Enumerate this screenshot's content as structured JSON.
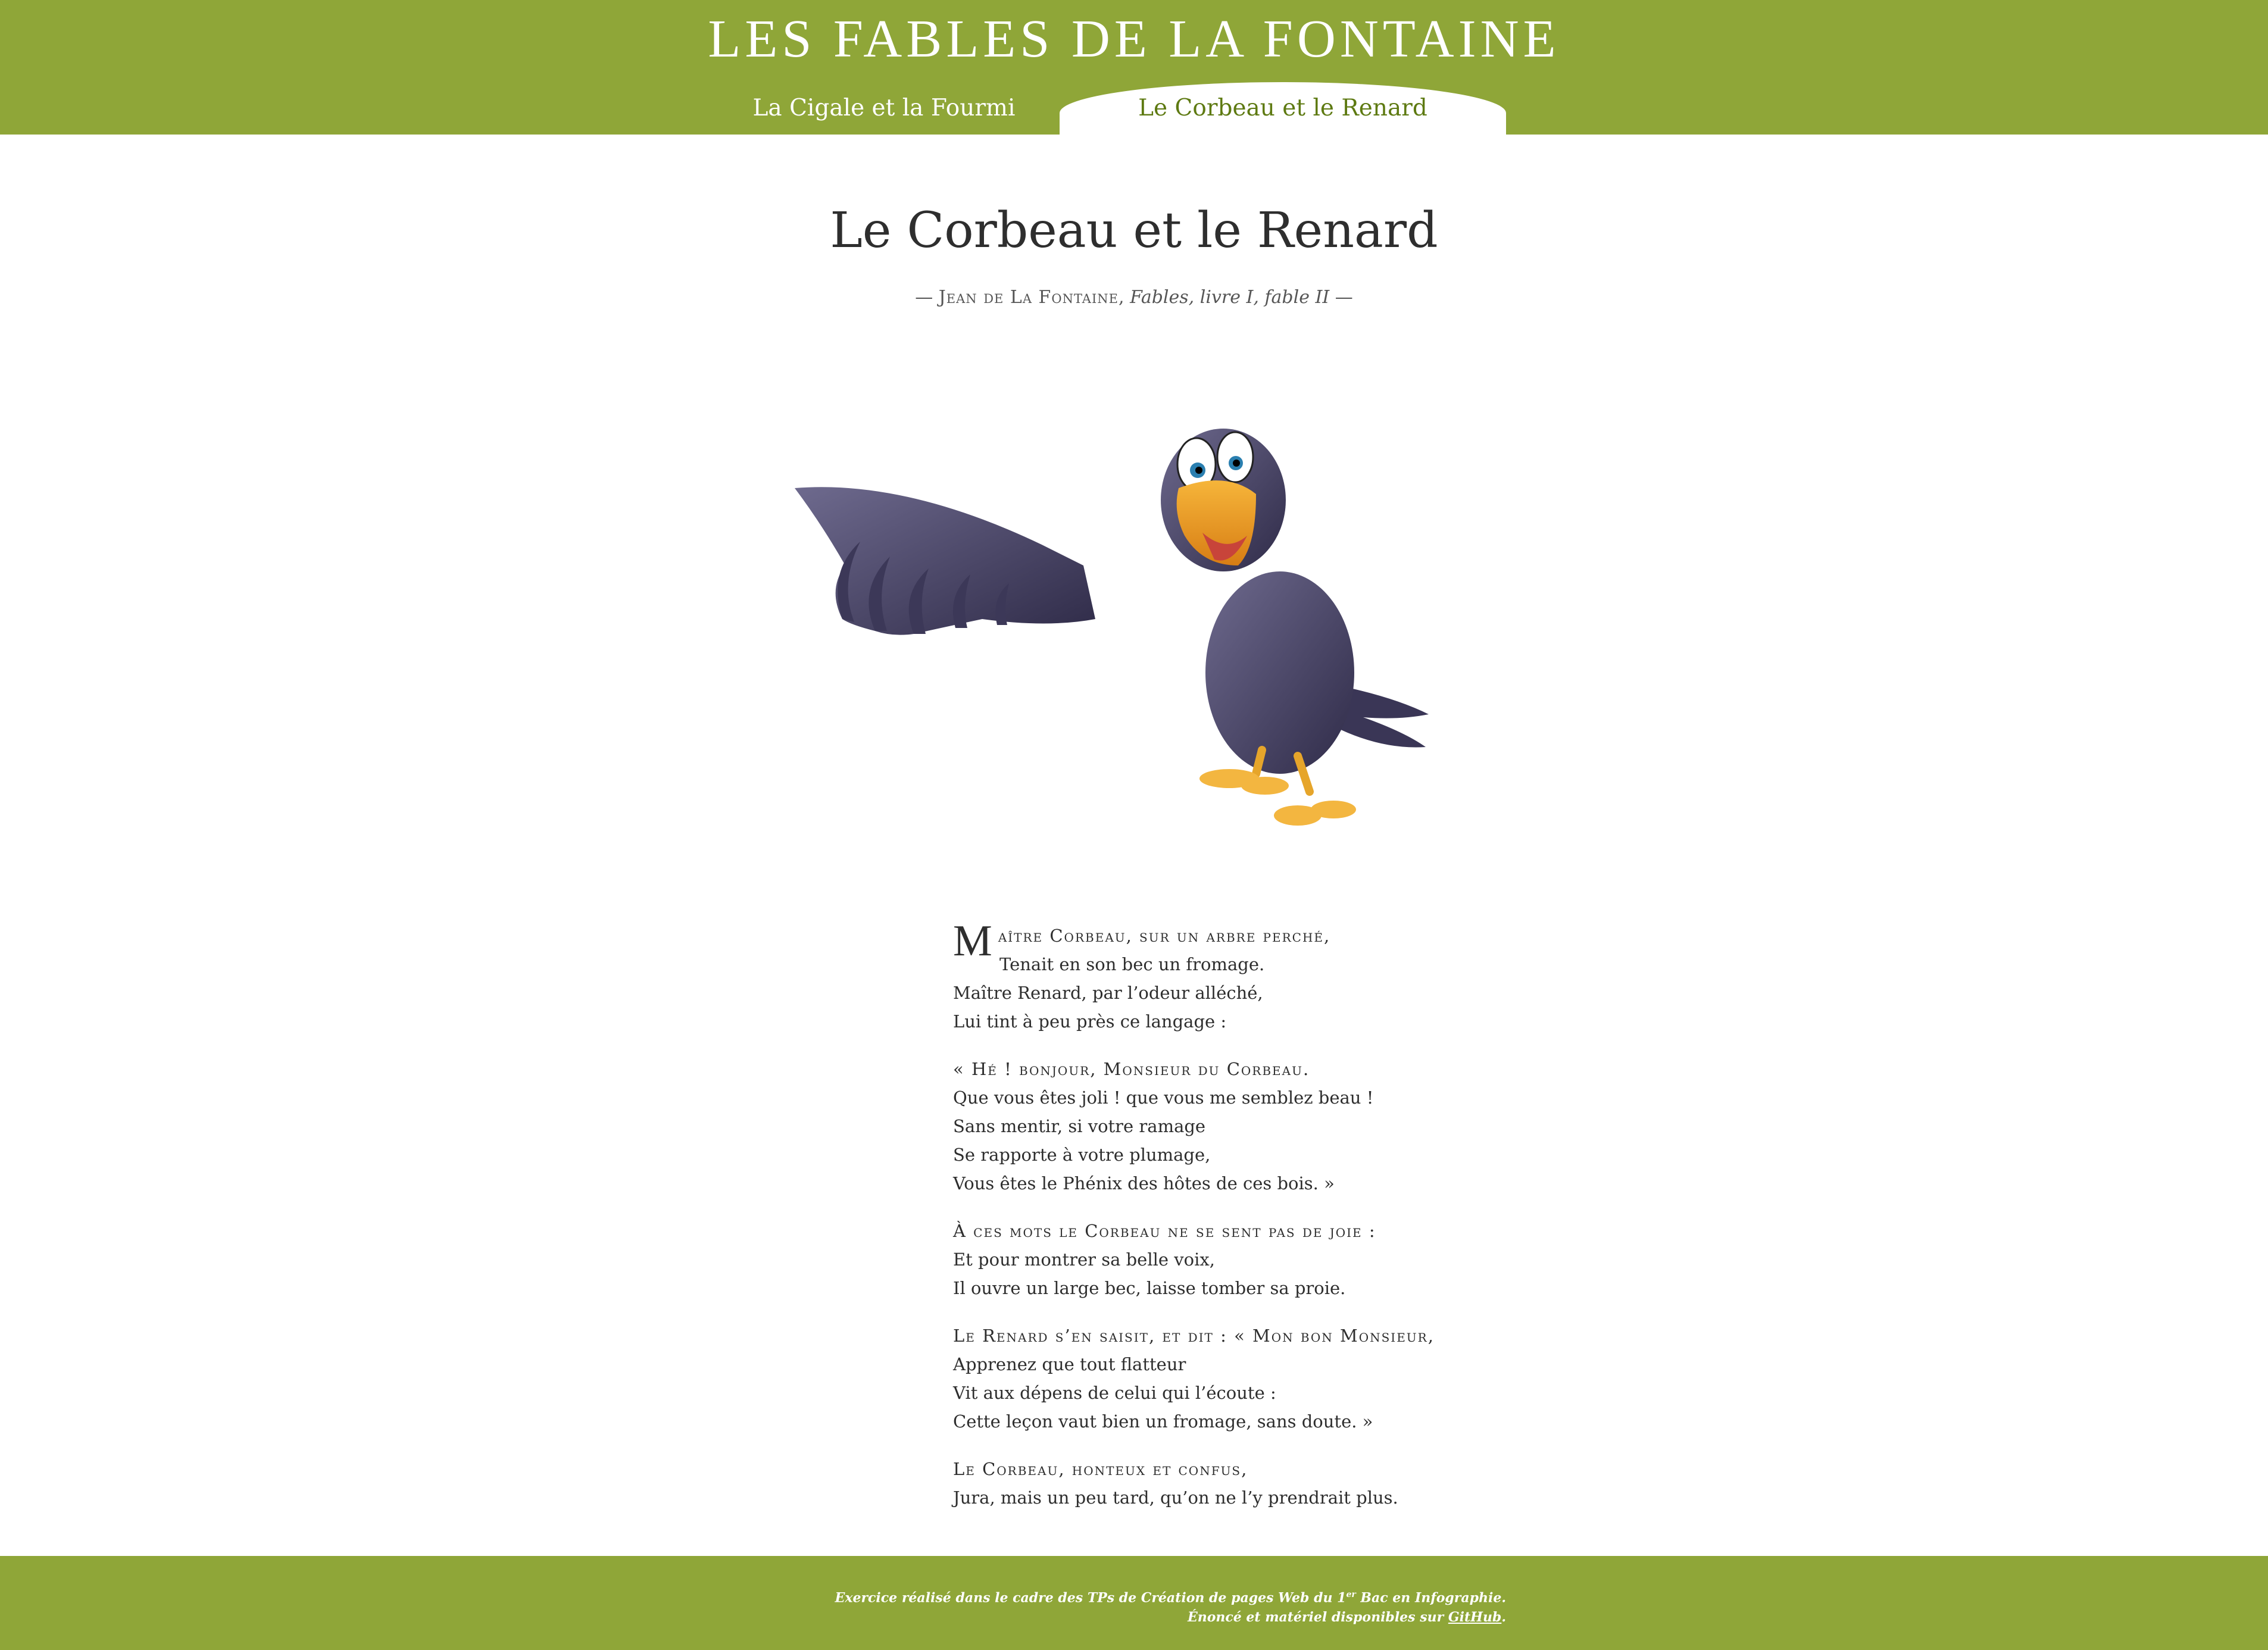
{
  "header": {
    "site_title": "LES FABLES DE LA FONTAINE",
    "tabs": [
      {
        "label": "La Cigale et la Fourmi",
        "active": false
      },
      {
        "label": "Le Corbeau et le Renard",
        "active": true
      }
    ]
  },
  "fable": {
    "title": "Le Corbeau et le Renard",
    "byline": {
      "dash_open": "— ",
      "author": "Jean de La Fontaine",
      "comma": ", ",
      "work": "Fables, livre I, fable II",
      "dash_close": " —"
    },
    "image_alt": "crow-cartoon",
    "stanzas": [
      {
        "lead_initial": "M",
        "lead_rest": "aître Corbeau, sur un arbre perché,",
        "lines": [
          "Tenait en son bec un fromage.",
          "Maître Renard, par l’odeur alléché,",
          "Lui tint à peu près ce langage :"
        ]
      },
      {
        "lead": "« Hé ! bonjour, Monsieur du Corbeau.",
        "lines": [
          "Que vous êtes joli ! que vous me semblez beau !",
          "Sans mentir, si votre ramage",
          "Se rapporte à votre plumage,",
          "Vous êtes le Phénix des hôtes de ces bois. »"
        ]
      },
      {
        "lead": "À ces mots le Corbeau ne se sent pas de joie :",
        "lines": [
          "Et pour montrer sa belle voix,",
          "Il ouvre un large bec, laisse tomber sa proie."
        ]
      },
      {
        "lead": "Le Renard s’en saisit, et dit : « Mon bon Monsieur,",
        "lines": [
          "Apprenez que tout flatteur",
          "Vit aux dépens de celui qui l’écoute :",
          "Cette leçon vaut bien un fromage, sans doute. »"
        ]
      },
      {
        "lead": "Le Corbeau, honteux et confus,",
        "lines": [
          "Jura, mais un peu tard, qu’on ne l’y prendrait plus."
        ]
      }
    ]
  },
  "footer": {
    "line1_a": "Exercice réalisé dans le cadre des TPs de Création de pages Web du 1",
    "line1_sup": "er",
    "line1_b": " Bac en Infographie.",
    "line2_a": "Énoncé et matériel disponibles sur ",
    "line2_link": "GitHub",
    "line2_b": "."
  },
  "colors": {
    "brand_green": "#8fa638",
    "active_tab_text": "#5e7a12"
  }
}
